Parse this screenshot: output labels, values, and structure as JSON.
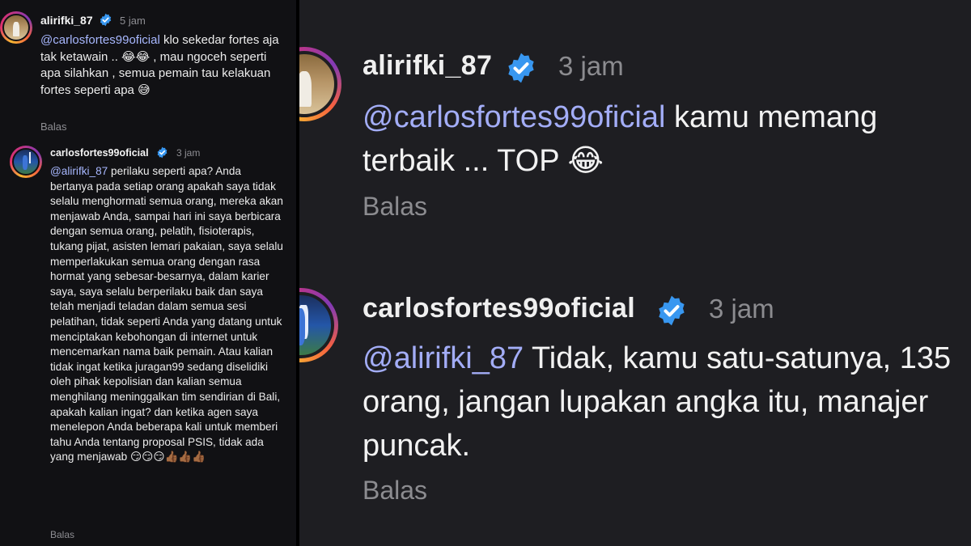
{
  "left_thread": {
    "comment1": {
      "username": "alirifki_87",
      "time": "5 jam",
      "mention": "@carlosfortes99oficial",
      "text": " klo sekedar fortes aja tak ketawain .. 😂😂 , mau ngoceh seperti apa silahkan , semua pemain tau kelakuan fortes seperti apa 😅",
      "reply_label": "Balas",
      "avatar": "alirifki-avatar"
    },
    "comment2": {
      "username": "carlosfortes99oficial",
      "time": "3 jam",
      "mention": "@alirifki_87",
      "text": " perilaku seperti apa? Anda bertanya pada setiap orang apakah saya tidak selalu menghormati semua orang, mereka akan menjawab Anda, sampai hari ini saya berbicara dengan semua orang, pelatih, fisioterapis, tukang pijat, asisten lemari pakaian, saya selalu memperlakukan semua orang dengan rasa hormat yang sebesar-besarnya, dalam karier saya, saya selalu berperilaku baik dan saya telah menjadi teladan dalam semua sesi pelatihan, tidak seperti Anda yang datang untuk menciptakan kebohongan di internet untuk mencemarkan nama baik pemain. Atau kalian tidak ingat ketika juragan99 sedang diselidiki oleh pihak kepolisian dan kalian semua menghilang meninggalkan tim sendirian di Bali, apakah kalian ingat? dan ketika agen saya menelepon Anda beberapa kali untuk memberi tahu Anda tentang proposal PSIS, tidak ada yang menjawab 😏😏😏👍🏾👍🏾👍🏾",
      "reply_label": "Balas",
      "avatar": "carlosfortes-avatar"
    }
  },
  "right_thread": {
    "comment1": {
      "username": "alirifki_87",
      "time": "3 jam",
      "mention": "@carlosfortes99oficial",
      "text": " kamu memang terbaik ... TOP 😂",
      "reply_label": "Balas"
    },
    "comment2": {
      "username": "carlosfortes99oficial",
      "time": "3 jam",
      "mention": "@alirifki_87",
      "text": " Tidak, kamu satu-satunya, 135 orang, jangan lupakan angka itu, manajer puncak.",
      "reply_label": "Balas"
    }
  },
  "colors": {
    "mention": "#a8b8ff",
    "verified": "#3897f0",
    "muted": "#8e8e93"
  }
}
